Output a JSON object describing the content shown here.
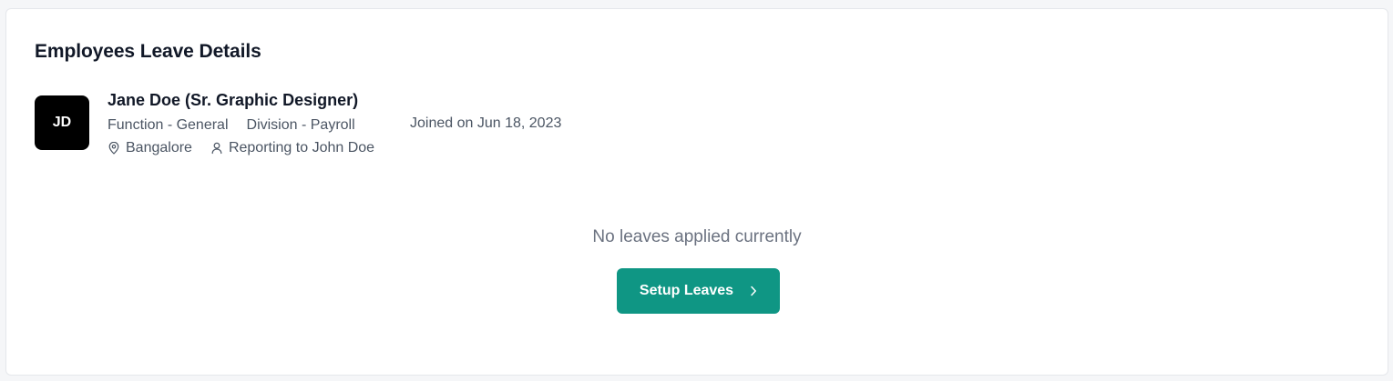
{
  "header": {
    "title": "Employees Leave Details"
  },
  "employee": {
    "initials": "JD",
    "name": "Jane Doe (Sr. Graphic Designer)",
    "function": "Function - General",
    "division": "Division - Payroll",
    "joined": "Joined on Jun 18, 2023",
    "location": "Bangalore",
    "reporting": "Reporting to John Doe",
    "location_icon": "map-pin-icon",
    "reporting_icon": "user-icon"
  },
  "empty_state": {
    "message": "No leaves applied currently",
    "button_label": "Setup Leaves",
    "button_icon": "chevron-right-icon"
  },
  "colors": {
    "accent": "#0f9684",
    "avatar_bg": "#000000"
  }
}
